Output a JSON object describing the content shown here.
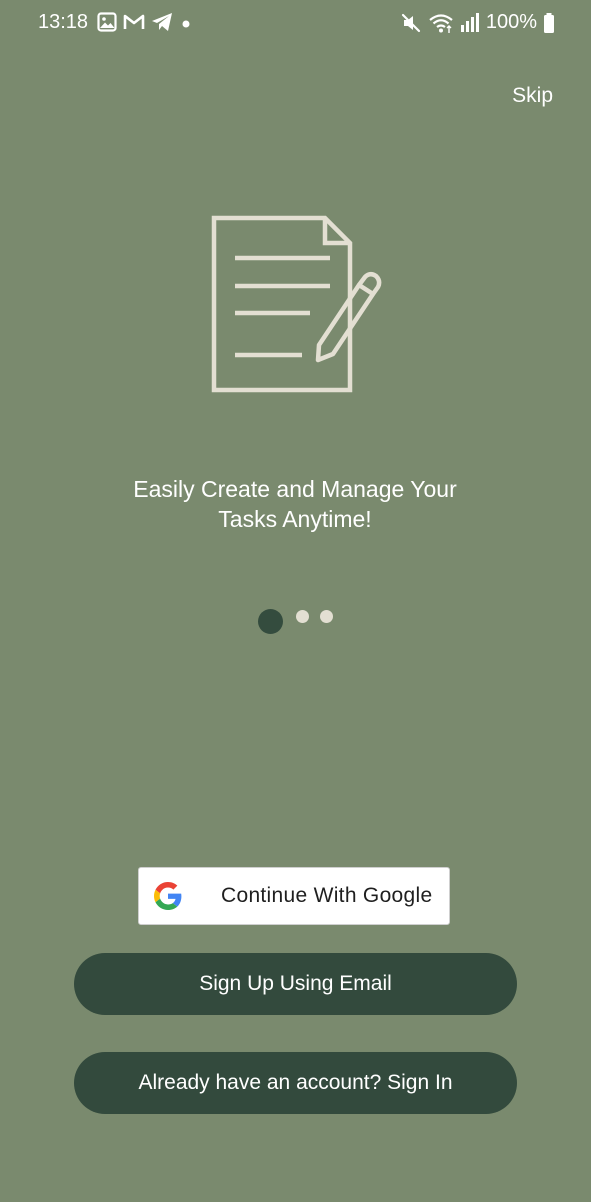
{
  "status_bar": {
    "time": "13:18",
    "battery": "100%",
    "left_icons": [
      "gallery-icon",
      "gmail-icon",
      "telegram-icon",
      "notification-dot-icon"
    ],
    "right_icons": [
      "mute-icon",
      "wifi-icon",
      "signal-icon",
      "battery-icon"
    ]
  },
  "header": {
    "skip_label": "Skip"
  },
  "onboarding": {
    "illustration_icon": "document-edit-icon",
    "headline_line1": "Easily Create and Manage Your",
    "headline_line2": "Tasks Anytime!",
    "page_indicator": {
      "total": 3,
      "current": 1
    }
  },
  "actions": {
    "google_label": "Continue With Google",
    "google_icon": "google-g-icon",
    "signup_label": "Sign Up Using Email",
    "signin_label": "Already have an account? Sign In"
  },
  "colors": {
    "background": "#7a8a6e",
    "primary_button": "#334a3d",
    "illustration_stroke": "#e3dfd2",
    "active_dot": "#344c3e"
  }
}
